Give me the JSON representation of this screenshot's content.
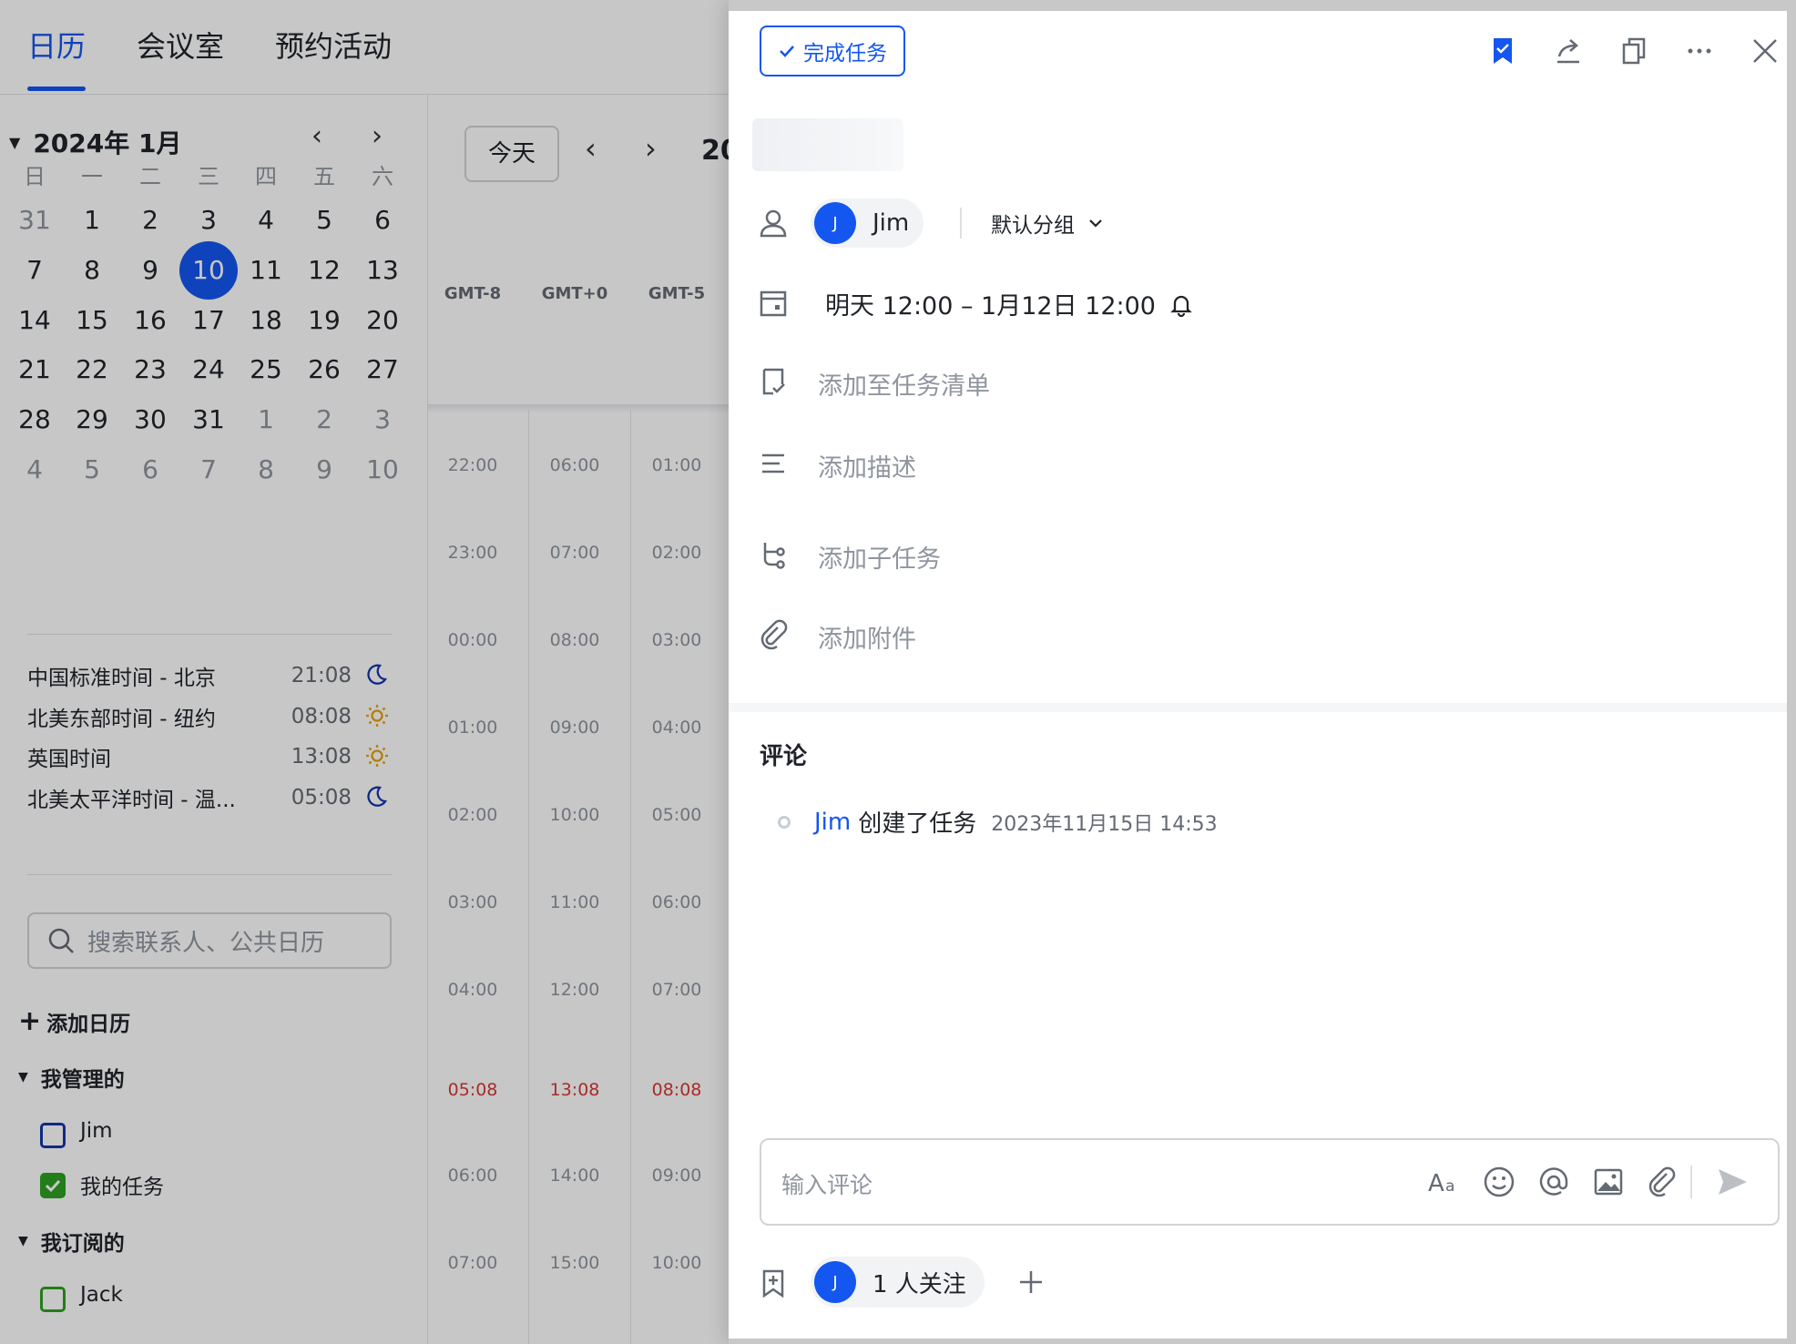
{
  "topnav": {
    "tabs": [
      "日历",
      "会议室",
      "预约活动"
    ]
  },
  "mini_calendar": {
    "month_label": "2024年 1月",
    "weekdays": [
      "日",
      "一",
      "二",
      "三",
      "四",
      "五",
      "六"
    ],
    "weeks": [
      [
        "31",
        "1",
        "2",
        "3",
        "4",
        "5",
        "6"
      ],
      [
        "7",
        "8",
        "9",
        "10",
        "11",
        "12",
        "13"
      ],
      [
        "14",
        "15",
        "16",
        "17",
        "18",
        "19",
        "20"
      ],
      [
        "21",
        "22",
        "23",
        "24",
        "25",
        "26",
        "27"
      ],
      [
        "28",
        "29",
        "30",
        "31",
        "1",
        "2",
        "3"
      ],
      [
        "4",
        "5",
        "6",
        "7",
        "8",
        "9",
        "10"
      ]
    ],
    "selected_day": "10"
  },
  "timezones": [
    {
      "name": "中国标准时间 - 北京",
      "time": "21:08",
      "icon": "moon-icon"
    },
    {
      "name": "北美东部时间 - 纽约",
      "time": "08:08",
      "icon": "sun-icon"
    },
    {
      "name": "英国时间",
      "time": "13:08",
      "icon": "sun-icon"
    },
    {
      "name": "北美太平洋时间 - 温...",
      "time": "05:08",
      "icon": "moon-icon"
    }
  ],
  "search": {
    "placeholder": "搜索联系人、公共日历"
  },
  "sidebar": {
    "add_calendar": "添加日历",
    "managed_title": "我管理的",
    "managed": [
      {
        "label": "Jim",
        "checked": false,
        "color": "#1435a8"
      },
      {
        "label": "我的任务",
        "checked": true,
        "color": "#2ea121"
      }
    ],
    "subscribed_title": "我订阅的",
    "subscribed": [
      {
        "label": "Jack",
        "checked": false,
        "color": "#2ea121"
      }
    ]
  },
  "grid": {
    "today_button": "今天",
    "year_partial": "20",
    "timezones": [
      "GMT-8",
      "GMT+0",
      "GMT-5"
    ],
    "hours": [
      [
        "22:00",
        "06:00",
        "01:00"
      ],
      [
        "23:00",
        "07:00",
        "02:00"
      ],
      [
        "00:00",
        "08:00",
        "03:00"
      ],
      [
        "01:00",
        "09:00",
        "04:00"
      ],
      [
        "02:00",
        "10:00",
        "05:00"
      ],
      [
        "03:00",
        "11:00",
        "06:00"
      ],
      [
        "04:00",
        "12:00",
        "07:00"
      ],
      [
        "05:08",
        "13:08",
        "08:08"
      ],
      [
        "06:00",
        "14:00",
        "09:00"
      ],
      [
        "07:00",
        "15:00",
        "10:00"
      ]
    ],
    "now_color": "#d83931"
  },
  "task": {
    "complete_button": "完成任务",
    "assignee": {
      "initial": "J",
      "name": "Jim"
    },
    "group": "默认分组",
    "due": "明天 12:00 – 1月12日 12:00",
    "add_to_list": "添加至任务清单",
    "add_description": "添加描述",
    "add_subtask": "添加子任务",
    "add_attachment": "添加附件"
  },
  "comments": {
    "title": "评论",
    "activity": {
      "user": "Jim",
      "action": "创建了任务",
      "time": "2023年11月15日 14:53"
    },
    "input_placeholder": "输入评论"
  },
  "followers": {
    "initial": "J",
    "label": "1 人关注"
  },
  "colors": {
    "accent": "#1456f0",
    "now": "#d83931"
  }
}
